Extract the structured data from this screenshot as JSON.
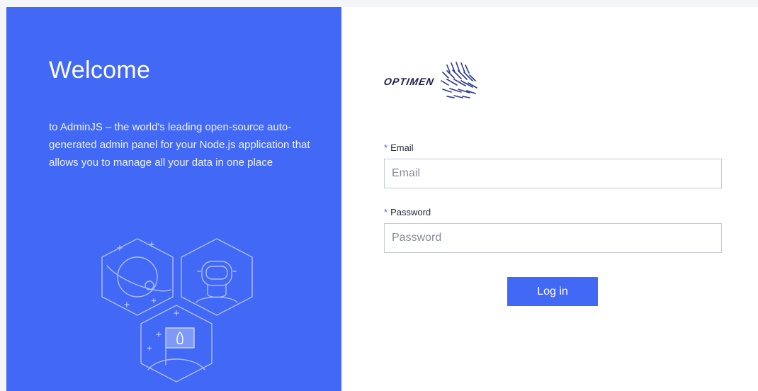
{
  "welcome": {
    "title": "Welcome",
    "text": "to AdminJS – the world's leading open-source auto-generated admin panel for your Node.js application that allows you to manage all your data in one place"
  },
  "brand": {
    "name": "OPTIMEN"
  },
  "form": {
    "email": {
      "required_mark": "*",
      "label": "Email",
      "placeholder": "Email",
      "value": ""
    },
    "password": {
      "required_mark": "*",
      "label": "Password",
      "placeholder": "Password",
      "value": ""
    },
    "submit_label": "Log in"
  },
  "colors": {
    "accent": "#4268f6",
    "panel_background": "#ffffff",
    "page_background": "#f4f5f8"
  },
  "icons": [
    "planet-icon",
    "astronaut-icon",
    "rocket-flag-icon",
    "optimen-logo-icon"
  ]
}
